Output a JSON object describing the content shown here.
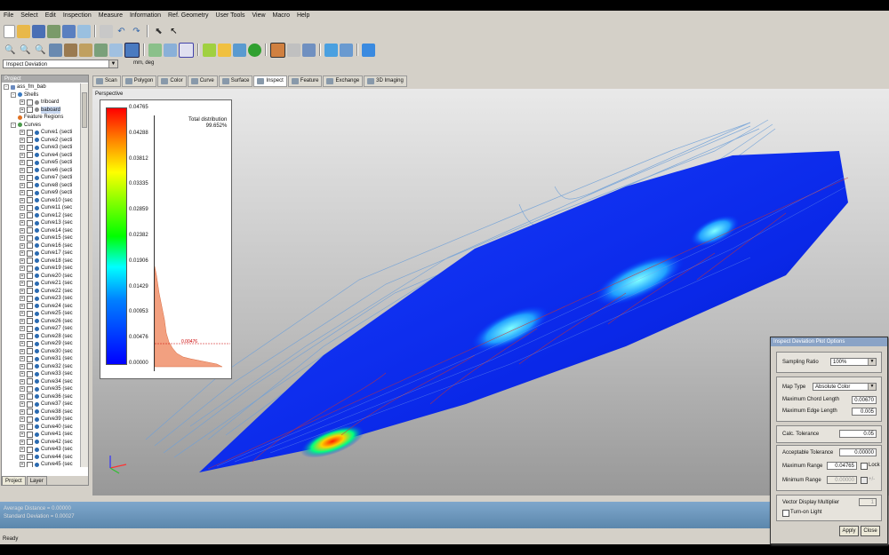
{
  "menu": [
    "File",
    "Select",
    "Edit",
    "Inspection",
    "Measure",
    "Information",
    "Ref. Geometry",
    "User Tools",
    "View",
    "Macro",
    "Help"
  ],
  "toolbar1_icons": [
    "new-icon",
    "open-icon",
    "save-icon",
    "scan-icon",
    "save-as-icon",
    "export-icon",
    "print-icon",
    "undo-icon",
    "redo-icon",
    "select-mode-icon",
    "pointer-icon"
  ],
  "toolbar2_icons": [
    "zoom-icon",
    "zoom-fit-icon",
    "zoom-window-icon",
    "rotate-icon",
    "pan-icon",
    "view-icon",
    "surface-icon",
    "wireframe-icon",
    "shade-icon",
    "points-icon",
    "section-icon",
    "mesh-icon",
    "model-icon",
    "light-icon",
    "target-icon",
    "inspect-icon",
    "grid-icon",
    "layer-icon",
    "visibility-icon",
    "settings-icon"
  ],
  "command_combo": "Inspect Deviation",
  "units_label": "mm, deg",
  "project": {
    "title": "Project",
    "root": "ass_fm_bab",
    "shells": "Shells",
    "shell_items": [
      "triboard",
      "baboard"
    ],
    "feature_regions": "Feature Regions",
    "curves_label": "Curves",
    "curves": [
      "Curve1 (secti",
      "Curve2 (secti",
      "Curve3 (secti",
      "Curve4 (secti",
      "Curve5 (secti",
      "Curve6 (secti",
      "Curve7 (secti",
      "Curve8 (secti",
      "Curve9 (secti",
      "Curve10 (sec",
      "Curve11 (sec",
      "Curve12 (sec",
      "Curve13 (sec",
      "Curve14 (sec",
      "Curve15 (sec",
      "Curve16 (sec",
      "Curve17 (sec",
      "Curve18 (sec",
      "Curve19 (sec",
      "Curve20 (sec",
      "Curve21 (sec",
      "Curve22 (sec",
      "Curve23 (sec",
      "Curve24 (sec",
      "Curve25 (sec",
      "Curve26 (sec",
      "Curve27 (sec",
      "Curve28 (sec",
      "Curve29 (sec",
      "Curve30 (sec",
      "Curve31 (sec",
      "Curve32 (sec",
      "Curve33 (sec",
      "Curve34 (sec",
      "Curve35 (sec",
      "Curve36 (sec",
      "Curve37 (sec",
      "Curve38 (sec",
      "Curve39 (sec",
      "Curve40 (sec",
      "Curve41 (sec",
      "Curve42 (sec",
      "Curve43 (sec",
      "Curve44 (sec",
      "Curve45 (sec"
    ],
    "tabs": [
      "Project",
      "Layer"
    ]
  },
  "mode_tabs": [
    "Scan",
    "Polygon",
    "Color",
    "Curve",
    "Surface",
    "Inspect",
    "Feature",
    "Exchange",
    "3D Imaging"
  ],
  "active_mode": "Inspect",
  "viewport_label": "Perspective",
  "legend": {
    "ticks": [
      "0.04765",
      "0.04288",
      "0.03812",
      "0.03335",
      "0.02859",
      "0.02382",
      "0.01906",
      "0.01429",
      "0.00953",
      "0.00476",
      "0.00000"
    ],
    "histogram_title": "Total distribution",
    "histogram_value": "99.652%",
    "marker_label": "0.00476"
  },
  "statistics": {
    "average": "Average Distance = 0.00000",
    "stddev": "Standard Deviation = 0.00027"
  },
  "status": "Ready",
  "dialog": {
    "title": "Inspect Deviation Plot Options",
    "sampling_ratio_label": "Sampling Ratio",
    "sampling_ratio_value": "100%",
    "map_type_label": "Map Type",
    "map_type_value": "Absolute Color",
    "max_chord_label": "Maximum Chord Length",
    "max_chord_value": "0.00670",
    "max_edge_label": "Maximum Edge Length",
    "max_edge_value": "0.005",
    "calc_tol_label": "Calc. Tolerance",
    "calc_tol_value": "0.05",
    "accept_tol_label": "Acceptable Tolerance",
    "accept_tol_value": "0.00000",
    "max_range_label": "Maximum Range",
    "max_range_value": "0.04765",
    "lock_label": "Lock",
    "min_range_label": "Minimum Range",
    "min_range_value": "0.00000",
    "sym_label": "+/-",
    "vector_mult_label": "Vector Display Multiplier",
    "vector_mult_value": "1",
    "turn_on_light_label": "Turn-on Light",
    "apply_label": "Apply",
    "close_label": "Close"
  }
}
